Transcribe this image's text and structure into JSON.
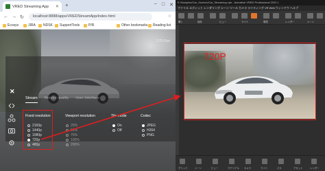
{
  "colors": {
    "highlight_red": "#e01e1e",
    "vred_accent": "#e3762b"
  },
  "browser": {
    "tab_title": "VRED Streaming App",
    "tab_close_icon": "close-icon",
    "new_tab_icon": "plus-icon",
    "window_controls": [
      "−",
      "□",
      "✕"
    ],
    "url": "localhost:8888/apps/VREDStreamApp/index.html",
    "bookmarks": [
      "Ecosys",
      "JIRA",
      "NDSK",
      "SupportTools",
      "P/R",
      "Other bookmarks",
      "Reading list"
    ]
  },
  "stream": {
    "fps": "175 Fps",
    "panel_tabs": [
      "Stream",
      "Render quality",
      "User Interface"
    ],
    "sidebar_icons": [
      "arrows-icon",
      "nodes-icon",
      "camera-icon",
      "settings-icon"
    ],
    "columns": [
      {
        "title": "Fixed resolution",
        "options": [
          "2160p",
          "1440p",
          "1080p",
          "720p",
          "480p"
        ],
        "selected": 3,
        "dim": false
      },
      {
        "title": "Viewport resolution",
        "options": [
          "25%",
          "50%",
          "75%",
          "100%",
          "200%"
        ],
        "selected": -1,
        "dim": true
      },
      {
        "title": "Tile mode",
        "options": [
          "On",
          "Off"
        ],
        "selected": 0,
        "dim": false
      },
      {
        "title": "Codec",
        "options": [
          "JPEG",
          "H264",
          "PNG"
        ],
        "selected": 0,
        "dim": false
      }
    ]
  },
  "vred": {
    "title": "E:/Samples/Car_Scenes/Car_Streaming.vpb - Autodesk VRED Professional 2022.1",
    "menu": "ファイル  エディット  レンダリング  シーン  ツール  カメラ  ライティング  VR  Web  ウィンドウ  ヘルプ",
    "toolbar_labels": [
      "開く",
      "保存",
      "ビュー",
      "ライト",
      "環境",
      "レンダー",
      "シーン"
    ],
    "resolution_label": "720P",
    "bottom_labels": [
      "グリッド",
      "シーン",
      "ビュー",
      "マテリアル",
      "カメラ",
      "ライト",
      "パス",
      "アセット",
      "レンダー"
    ]
  }
}
